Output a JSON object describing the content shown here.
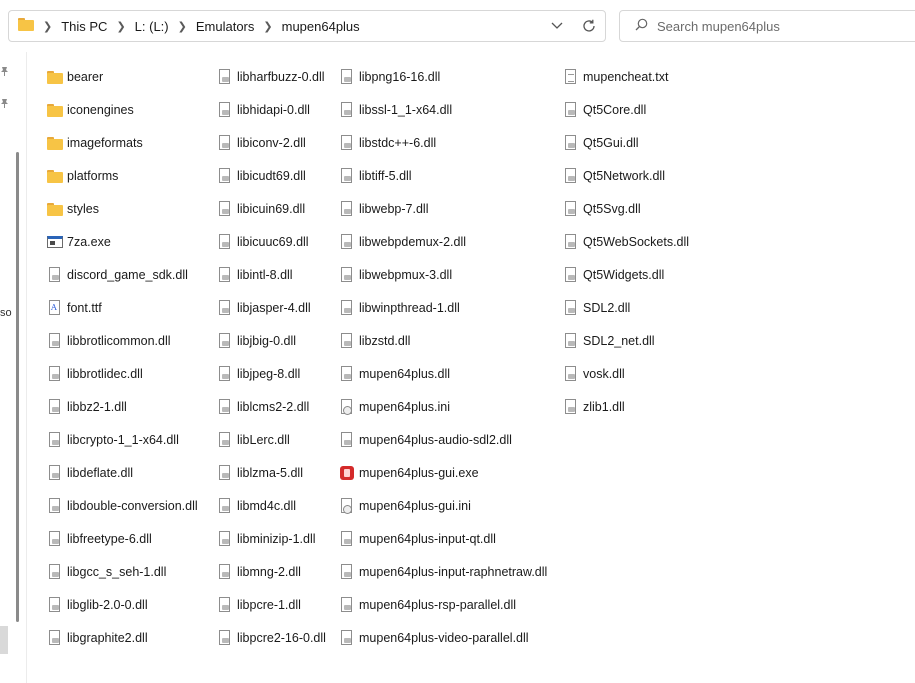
{
  "address": {
    "crumbs": [
      "This PC",
      "L: (L:)",
      "Emulators",
      "mupen64plus"
    ]
  },
  "search": {
    "placeholder": "Search mupen64plus"
  },
  "nav": {
    "cut_label": "so"
  },
  "files": [
    [
      {
        "name": "bearer",
        "type": "folder"
      },
      {
        "name": "iconengines",
        "type": "folder"
      },
      {
        "name": "imageformats",
        "type": "folder"
      },
      {
        "name": "platforms",
        "type": "folder"
      },
      {
        "name": "styles",
        "type": "folder"
      },
      {
        "name": "7za.exe",
        "type": "exe"
      },
      {
        "name": "discord_game_sdk.dll",
        "type": "dll"
      },
      {
        "name": "font.ttf",
        "type": "ttf"
      },
      {
        "name": "libbrotlicommon.dll",
        "type": "dll"
      },
      {
        "name": "libbrotlidec.dll",
        "type": "dll"
      },
      {
        "name": "libbz2-1.dll",
        "type": "dll"
      },
      {
        "name": "libcrypto-1_1-x64.dll",
        "type": "dll"
      },
      {
        "name": "libdeflate.dll",
        "type": "dll"
      },
      {
        "name": "libdouble-conversion.dll",
        "type": "dll"
      },
      {
        "name": "libfreetype-6.dll",
        "type": "dll"
      },
      {
        "name": "libgcc_s_seh-1.dll",
        "type": "dll"
      },
      {
        "name": "libglib-2.0-0.dll",
        "type": "dll"
      },
      {
        "name": "libgraphite2.dll",
        "type": "dll"
      }
    ],
    [
      {
        "name": "libharfbuzz-0.dll",
        "type": "dll"
      },
      {
        "name": "libhidapi-0.dll",
        "type": "dll"
      },
      {
        "name": "libiconv-2.dll",
        "type": "dll"
      },
      {
        "name": "libicudt69.dll",
        "type": "dll"
      },
      {
        "name": "libicuin69.dll",
        "type": "dll"
      },
      {
        "name": "libicuuc69.dll",
        "type": "dll"
      },
      {
        "name": "libintl-8.dll",
        "type": "dll"
      },
      {
        "name": "libjasper-4.dll",
        "type": "dll"
      },
      {
        "name": "libjbig-0.dll",
        "type": "dll"
      },
      {
        "name": "libjpeg-8.dll",
        "type": "dll"
      },
      {
        "name": "liblcms2-2.dll",
        "type": "dll"
      },
      {
        "name": "libLerc.dll",
        "type": "dll"
      },
      {
        "name": "liblzma-5.dll",
        "type": "dll"
      },
      {
        "name": "libmd4c.dll",
        "type": "dll"
      },
      {
        "name": "libminizip-1.dll",
        "type": "dll"
      },
      {
        "name": "libmng-2.dll",
        "type": "dll"
      },
      {
        "name": "libpcre-1.dll",
        "type": "dll"
      },
      {
        "name": "libpcre2-16-0.dll",
        "type": "dll"
      }
    ],
    [
      {
        "name": "libpng16-16.dll",
        "type": "dll"
      },
      {
        "name": "libssl-1_1-x64.dll",
        "type": "dll"
      },
      {
        "name": "libstdc++-6.dll",
        "type": "dll"
      },
      {
        "name": "libtiff-5.dll",
        "type": "dll"
      },
      {
        "name": "libwebp-7.dll",
        "type": "dll"
      },
      {
        "name": "libwebpdemux-2.dll",
        "type": "dll"
      },
      {
        "name": "libwebpmux-3.dll",
        "type": "dll"
      },
      {
        "name": "libwinpthread-1.dll",
        "type": "dll"
      },
      {
        "name": "libzstd.dll",
        "type": "dll"
      },
      {
        "name": "mupen64plus.dll",
        "type": "dll"
      },
      {
        "name": "mupen64plus.ini",
        "type": "ini"
      },
      {
        "name": "mupen64plus-audio-sdl2.dll",
        "type": "dll"
      },
      {
        "name": "mupen64plus-gui.exe",
        "type": "gui"
      },
      {
        "name": "mupen64plus-gui.ini",
        "type": "ini"
      },
      {
        "name": "mupen64plus-input-qt.dll",
        "type": "dll"
      },
      {
        "name": "mupen64plus-input-raphnetraw.dll",
        "type": "dll"
      },
      {
        "name": "mupen64plus-rsp-parallel.dll",
        "type": "dll"
      },
      {
        "name": "mupen64plus-video-parallel.dll",
        "type": "dll"
      }
    ],
    [
      {
        "name": "mupencheat.txt",
        "type": "doc"
      },
      {
        "name": "Qt5Core.dll",
        "type": "dll"
      },
      {
        "name": "Qt5Gui.dll",
        "type": "dll"
      },
      {
        "name": "Qt5Network.dll",
        "type": "dll"
      },
      {
        "name": "Qt5Svg.dll",
        "type": "dll"
      },
      {
        "name": "Qt5WebSockets.dll",
        "type": "dll"
      },
      {
        "name": "Qt5Widgets.dll",
        "type": "dll"
      },
      {
        "name": "SDL2.dll",
        "type": "dll"
      },
      {
        "name": "SDL2_net.dll",
        "type": "dll"
      },
      {
        "name": "vosk.dll",
        "type": "dll"
      },
      {
        "name": "zlib1.dll",
        "type": "dll"
      }
    ]
  ]
}
